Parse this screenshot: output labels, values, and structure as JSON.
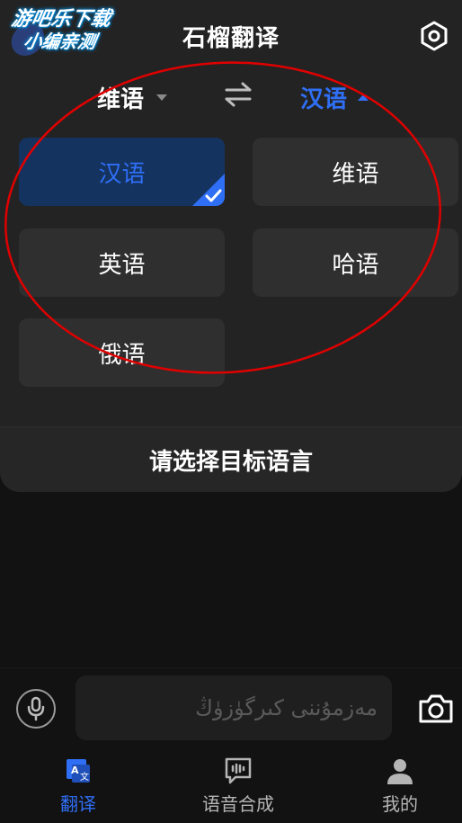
{
  "watermark": {
    "line1": "游吧乐下载",
    "line2": "小编亲测"
  },
  "header": {
    "title": "石榴翻译",
    "settings_icon": "settings-hexagon-icon"
  },
  "selector": {
    "source": "维语",
    "target": "汉语",
    "swap_icon": "swap-arrows-icon"
  },
  "languages": [
    {
      "label": "汉语",
      "selected": true
    },
    {
      "label": "维语",
      "selected": false
    },
    {
      "label": "英语",
      "selected": false
    },
    {
      "label": "哈语",
      "selected": false
    },
    {
      "label": "俄语",
      "selected": false
    }
  ],
  "hint": "请选择目标语言",
  "input": {
    "placeholder": "مەزمۇننى كىرگۈزۈڭ",
    "mic_icon": "microphone-icon",
    "camera_icon": "camera-icon"
  },
  "nav": [
    {
      "label": "翻译",
      "icon": "translate-icon",
      "active": true
    },
    {
      "label": "语音合成",
      "icon": "speech-synthesis-icon",
      "active": false
    },
    {
      "label": "我的",
      "icon": "profile-icon",
      "active": false
    }
  ],
  "colors": {
    "accent": "#2f6ff5",
    "background": "#121212",
    "panel": "#232323",
    "annotation": "#e00000"
  }
}
